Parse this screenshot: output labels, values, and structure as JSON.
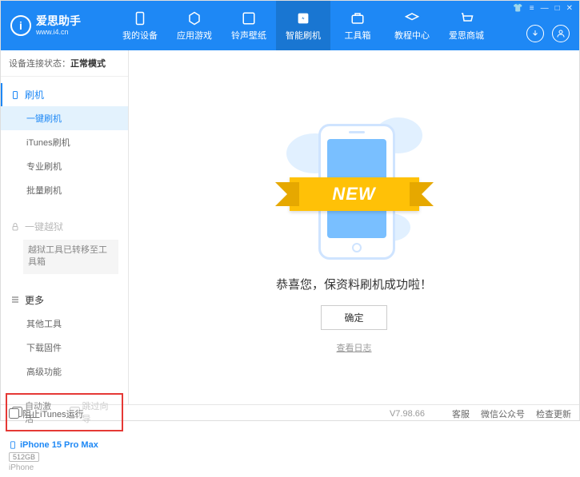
{
  "app": {
    "title": "爱思助手",
    "subtitle": "www.i4.cn",
    "logo_char": "i"
  },
  "nav": [
    {
      "id": "device",
      "label": "我的设备"
    },
    {
      "id": "apps",
      "label": "应用游戏"
    },
    {
      "id": "ringtone",
      "label": "铃声壁纸"
    },
    {
      "id": "flash",
      "label": "智能刷机"
    },
    {
      "id": "toolbox",
      "label": "工具箱"
    },
    {
      "id": "tutorial",
      "label": "教程中心"
    },
    {
      "id": "store",
      "label": "爱思商城"
    }
  ],
  "nav_active": 3,
  "conn": {
    "label": "设备连接状态：",
    "mode": "正常模式"
  },
  "side": {
    "flash": {
      "title": "刷机",
      "items": [
        "一键刷机",
        "iTunes刷机",
        "专业刷机",
        "批量刷机"
      ],
      "active": 0
    },
    "jailbreak": {
      "title": "一键越狱",
      "note": "越狱工具已转移至工具箱"
    },
    "more": {
      "title": "更多",
      "items": [
        "其他工具",
        "下载固件",
        "高级功能"
      ]
    }
  },
  "options": {
    "auto_activate": "自动激活",
    "skip_guide": "跳过向导"
  },
  "device": {
    "name": "iPhone 15 Pro Max",
    "storage": "512GB",
    "type": "iPhone"
  },
  "main": {
    "ribbon": "NEW",
    "success": "恭喜您，保资料刷机成功啦！",
    "ok": "确定",
    "log": "查看日志"
  },
  "footer": {
    "block_itunes": "阻止iTunes运行",
    "version": "V7.98.66",
    "links": [
      "客服",
      "微信公众号",
      "检查更新"
    ]
  }
}
